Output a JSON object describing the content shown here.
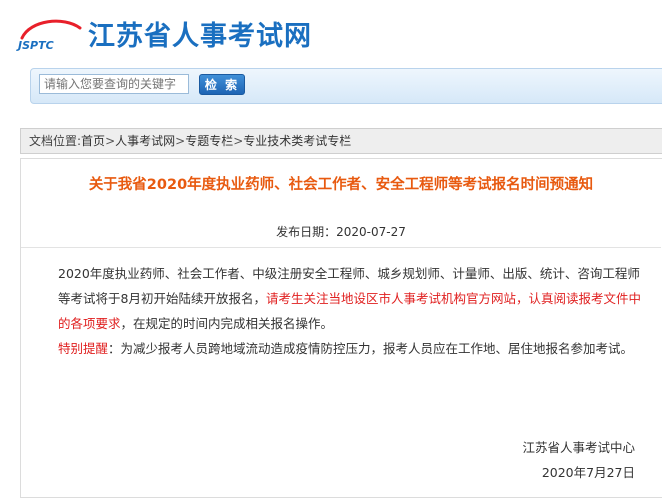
{
  "header": {
    "logo_text": "JSPTC",
    "site_title": "江苏省人事考试网",
    "brand_color": "#1a6fc0"
  },
  "search": {
    "placeholder": "请输入您要查询的关键字",
    "button_label": "检 索"
  },
  "breadcrumb": {
    "prefix": "文档位置:",
    "items": [
      "首页",
      "人事考试网",
      "专题专栏",
      "专业技术类考试专栏"
    ],
    "separator": ">"
  },
  "article": {
    "title": "关于我省2020年度执业药师、社会工作者、安全工程师等考试报名时间预通知",
    "publish_label": "发布日期：",
    "publish_date": "2020-07-27",
    "para1_normal": "2020年度执业药师、社会工作者、中级注册安全工程师、城乡规划师、计量师、出版、统计、咨询工程师等考试将于8月初开始陆续开放报名，",
    "para1_red": "请考生关注当地设区市人事考试机构官方网站，认真阅读报考文件中的各项要求",
    "para1_end": "，在规定的时间内完成相关报名操作。",
    "para2_red": "特别提醒",
    "para2_normal": "：为减少报考人员跨地域流动造成疫情防控压力，报考人员应在工作地、居住地报名参加考试。",
    "signature_org": "江苏省人事考试中心",
    "signature_date": "2020年7月27日",
    "title_color": "#e85a10",
    "highlight_color": "#e02020"
  }
}
